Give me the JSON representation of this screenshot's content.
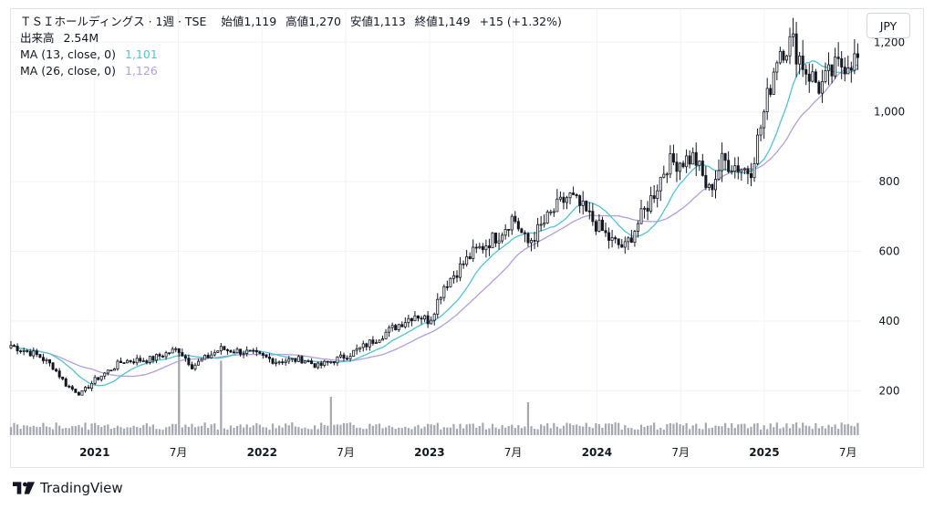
{
  "header": {
    "title": "ＴＳＩホールディングス · 1週 · TSE",
    "open_label": "始値",
    "open": "1,119",
    "high_label": "高値",
    "high": "1,270",
    "low_label": "安値",
    "low": "1,113",
    "close_label": "終値",
    "close": "1,149",
    "change": "+15 (+1.32%)"
  },
  "volume": {
    "label": "出来高",
    "value": "2.54M"
  },
  "ma13": {
    "label": "MA (13, close, 0)",
    "value": "1,101",
    "color": "#4fc3d6"
  },
  "ma26": {
    "label": "MA (26, close, 0)",
    "value": "1,126",
    "color": "#b39ddb"
  },
  "currency_button": "JPY",
  "brand": "TradingView",
  "chart_data": {
    "type": "candlestick",
    "timeframe": "1週",
    "y_axis": {
      "ticks": [
        "200",
        "400",
        "600",
        "800",
        "1,000",
        "1,200"
      ],
      "tick_values": [
        200,
        400,
        600,
        800,
        1000,
        1200
      ],
      "range": [
        70,
        1295
      ],
      "position": "right"
    },
    "x_axis": {
      "ticks": [
        "2021",
        "7月",
        "2022",
        "7月",
        "2023",
        "7月",
        "2024",
        "7月",
        "2025",
        "7月"
      ],
      "tick_dates": [
        "2021-01",
        "2021-07",
        "2022-01",
        "2022-07",
        "2023-01",
        "2023-07",
        "2024-01",
        "2024-07",
        "2025-01",
        "2025-07"
      ],
      "range": [
        "2020-07",
        "2025-08"
      ]
    },
    "grid": true,
    "series": [
      {
        "name": "price",
        "type": "candlestick"
      },
      {
        "name": "MA (13, close, 0)",
        "type": "line",
        "color": "#4fc3d6"
      },
      {
        "name": "MA (26, close, 0)",
        "type": "line",
        "color": "#b39ddb"
      },
      {
        "name": "出来高",
        "type": "volume"
      }
    ],
    "close_path": [
      [
        "2020-07",
        330
      ],
      [
        "2020-09",
        300
      ],
      [
        "2020-10",
        270
      ],
      [
        "2020-11",
        215
      ],
      [
        "2020-12",
        190
      ],
      [
        "2021-01",
        230
      ],
      [
        "2021-03",
        285
      ],
      [
        "2021-05",
        290
      ],
      [
        "2021-07",
        320
      ],
      [
        "2021-08",
        270
      ],
      [
        "2021-10",
        320
      ],
      [
        "2021-12",
        310
      ],
      [
        "2022-02",
        285
      ],
      [
        "2022-04",
        290
      ],
      [
        "2022-05",
        270
      ],
      [
        "2022-07",
        300
      ],
      [
        "2022-08",
        320
      ],
      [
        "2022-10",
        370
      ],
      [
        "2022-12",
        420
      ],
      [
        "2023-01",
        400
      ],
      [
        "2023-02",
        500
      ],
      [
        "2023-04",
        590
      ],
      [
        "2023-06",
        650
      ],
      [
        "2023-07",
        700
      ],
      [
        "2023-08",
        620
      ],
      [
        "2023-10",
        720
      ],
      [
        "2023-11",
        760
      ],
      [
        "2023-12",
        720
      ],
      [
        "2024-02",
        630
      ],
      [
        "2024-03",
        610
      ],
      [
        "2024-05",
        760
      ],
      [
        "2024-06",
        850
      ],
      [
        "2024-08",
        870
      ],
      [
        "2024-09",
        770
      ],
      [
        "2024-10",
        860
      ],
      [
        "2024-12",
        830
      ],
      [
        "2025-01",
        1000
      ],
      [
        "2025-02",
        1180
      ],
      [
        "2025-03",
        1200
      ],
      [
        "2025-04",
        1120
      ],
      [
        "2025-05",
        1070
      ],
      [
        "2025-06",
        1120
      ],
      [
        "2025-07",
        1149
      ]
    ],
    "volume_spikes": [
      [
        "2021-07",
        0.75
      ],
      [
        "2021-10",
        0.68
      ],
      [
        "2022-06",
        0.35
      ],
      [
        "2023-08",
        0.3
      ]
    ]
  }
}
